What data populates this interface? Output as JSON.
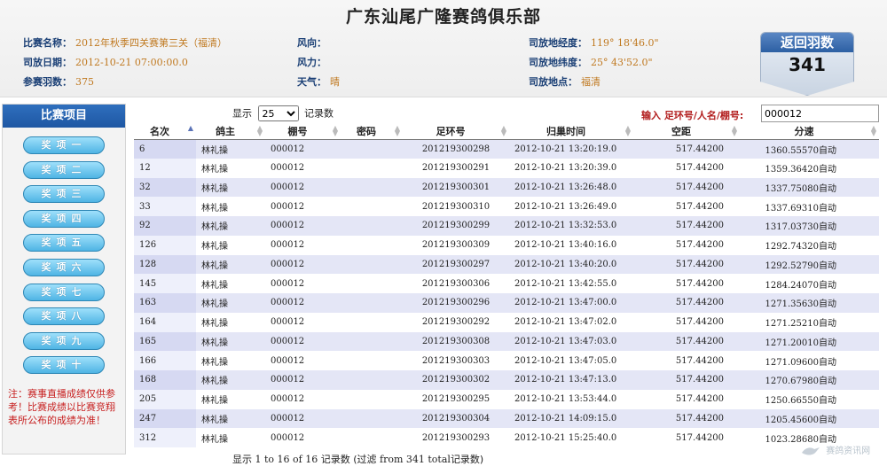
{
  "header": {
    "title": "广东汕尾广隆赛鸽俱乐部",
    "race_name_label": "比赛名称：",
    "race_name": "2012年秋季四关赛第三关（福清）",
    "release_date_label": "司放日期：",
    "release_date": "2012-10-21 07:00:00.0",
    "entries_label": "参赛羽数：",
    "entries": "375",
    "wind_dir_label": "风向：",
    "wind_dir": "",
    "wind_force_label": "风力：",
    "wind_force": "",
    "weather_label": "天气：",
    "weather": "晴",
    "longitude_label": "司放地经度：",
    "longitude": "119° 18'46.0\"",
    "latitude_label": "司放地纬度：",
    "latitude": "25° 43'52.0\"",
    "location_label": "司放地点：",
    "location": "福清",
    "returned_label": "返回羽数",
    "returned_count": "341"
  },
  "sidebar": {
    "title": "比赛项目",
    "items": [
      "奖项一",
      "奖项二",
      "奖项三",
      "奖项四",
      "奖项五",
      "奖项六",
      "奖项七",
      "奖项八",
      "奖项九",
      "奖项十"
    ],
    "note": "注：赛事直播成绩仅供参考！比赛成绩以比赛竞翔表所公布的成绩为准！"
  },
  "controls": {
    "show_label": "显示",
    "page_size": "25",
    "page_size_suffix": "记录数",
    "search_label": "输入 足环号/人名/棚号:",
    "search_value": "000012"
  },
  "table": {
    "columns": [
      "名次",
      "鸽主",
      "棚号",
      "密码",
      "足环号",
      "归巢时间",
      "空距",
      "分速"
    ],
    "rows": [
      [
        "6",
        "林礼操",
        "000012",
        "",
        "201219300298",
        "2012-10-21 13:20:19.0",
        "517.44200",
        "1360.55570自动"
      ],
      [
        "12",
        "林礼操",
        "000012",
        "",
        "201219300291",
        "2012-10-21 13:20:39.0",
        "517.44200",
        "1359.36420自动"
      ],
      [
        "32",
        "林礼操",
        "000012",
        "",
        "201219300301",
        "2012-10-21 13:26:48.0",
        "517.44200",
        "1337.75080自动"
      ],
      [
        "33",
        "林礼操",
        "000012",
        "",
        "201219300310",
        "2012-10-21 13:26:49.0",
        "517.44200",
        "1337.69310自动"
      ],
      [
        "92",
        "林礼操",
        "000012",
        "",
        "201219300299",
        "2012-10-21 13:32:53.0",
        "517.44200",
        "1317.03730自动"
      ],
      [
        "126",
        "林礼操",
        "000012",
        "",
        "201219300309",
        "2012-10-21 13:40:16.0",
        "517.44200",
        "1292.74320自动"
      ],
      [
        "128",
        "林礼操",
        "000012",
        "",
        "201219300297",
        "2012-10-21 13:40:20.0",
        "517.44200",
        "1292.52790自动"
      ],
      [
        "145",
        "林礼操",
        "000012",
        "",
        "201219300306",
        "2012-10-21 13:42:55.0",
        "517.44200",
        "1284.24070自动"
      ],
      [
        "163",
        "林礼操",
        "000012",
        "",
        "201219300296",
        "2012-10-21 13:47:00.0",
        "517.44200",
        "1271.35630自动"
      ],
      [
        "164",
        "林礼操",
        "000012",
        "",
        "201219300292",
        "2012-10-21 13:47:02.0",
        "517.44200",
        "1271.25210自动"
      ],
      [
        "165",
        "林礼操",
        "000012",
        "",
        "201219300308",
        "2012-10-21 13:47:03.0",
        "517.44200",
        "1271.20010自动"
      ],
      [
        "166",
        "林礼操",
        "000012",
        "",
        "201219300303",
        "2012-10-21 13:47:05.0",
        "517.44200",
        "1271.09600自动"
      ],
      [
        "168",
        "林礼操",
        "000012",
        "",
        "201219300302",
        "2012-10-21 13:47:13.0",
        "517.44200",
        "1270.67980自动"
      ],
      [
        "205",
        "林礼操",
        "000012",
        "",
        "201219300295",
        "2012-10-21 13:53:44.0",
        "517.44200",
        "1250.66550自动"
      ],
      [
        "247",
        "林礼操",
        "000012",
        "",
        "201219300304",
        "2012-10-21 14:09:15.0",
        "517.44200",
        "1205.45600自动"
      ],
      [
        "312",
        "林礼操",
        "000012",
        "",
        "201219300293",
        "2012-10-21 15:25:40.0",
        "517.44200",
        "1023.28680自动"
      ]
    ]
  },
  "footer": {
    "info_prefix": "显示",
    "info_range": "1 to 16 of 16",
    "info_unit": "记录数",
    "info_filter": "(过滤",
    "info_total": "from 341 total",
    "info_suffix": "记录数)"
  },
  "watermark": "赛鸽资讯网"
}
